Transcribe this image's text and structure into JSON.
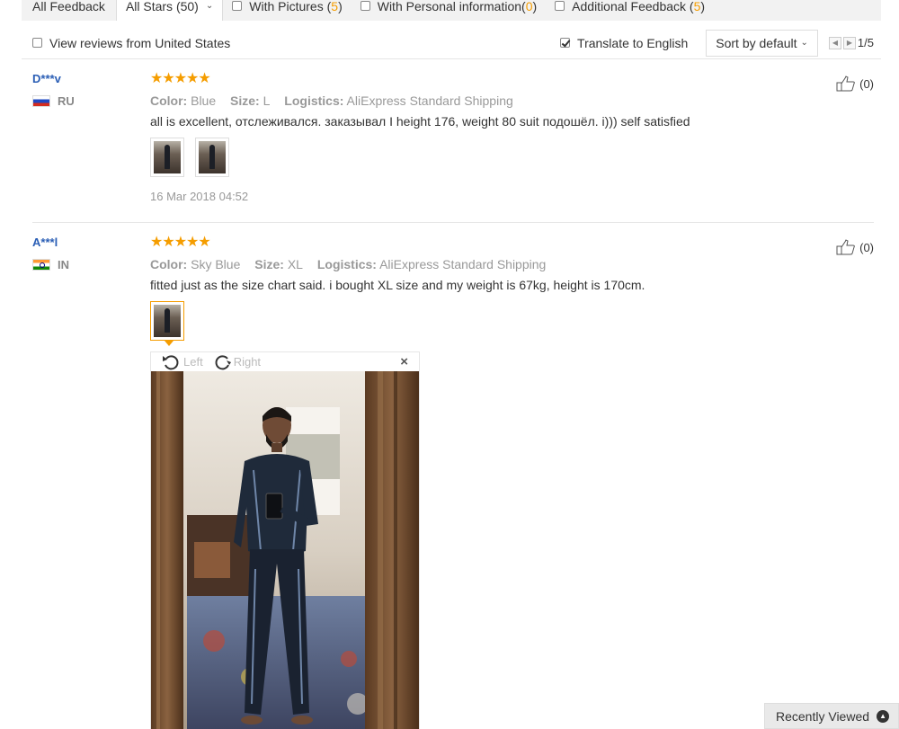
{
  "filters": {
    "all_feedback": "All Feedback",
    "all_stars": "All Stars (50)",
    "with_pictures_label": "With Pictures (",
    "with_pictures_count": "5",
    "personal_info_label": "With Personal information(",
    "personal_info_count": "0",
    "additional_label": "Additional Feedback (",
    "additional_count": "5",
    "close_paren": ")"
  },
  "options": {
    "view_us": "View reviews from United States",
    "translate": "Translate to English",
    "sort": "Sort by default",
    "page": "1/5"
  },
  "reviews": [
    {
      "name": "D***v",
      "country": "RU",
      "stars": "★★★★★",
      "color_label": "Color:",
      "color": "Blue",
      "size_label": "Size:",
      "size": "L",
      "logistics_label": "Logistics:",
      "logistics": "AliExpress Standard Shipping",
      "text": "all is excellent, отслеживался. заказывал I height 176, weight 80 suit подошёл. i))) self satisfied",
      "date": "16 Mar 2018 04:52",
      "helpful": "(0)"
    },
    {
      "name": "A***l",
      "country": "IN",
      "stars": "★★★★★",
      "color_label": "Color:",
      "color": "Sky Blue",
      "size_label": "Size:",
      "size": "XL",
      "logistics_label": "Logistics:",
      "logistics": "AliExpress Standard Shipping",
      "text": "fitted just as the size chart said. i bought XL size and my weight is 67kg, height is 170cm.",
      "helpful": "(0)"
    }
  ],
  "viewer": {
    "rotate_left": "Left",
    "rotate_right": "Right",
    "close": "×"
  },
  "recently_viewed": "Recently Viewed"
}
